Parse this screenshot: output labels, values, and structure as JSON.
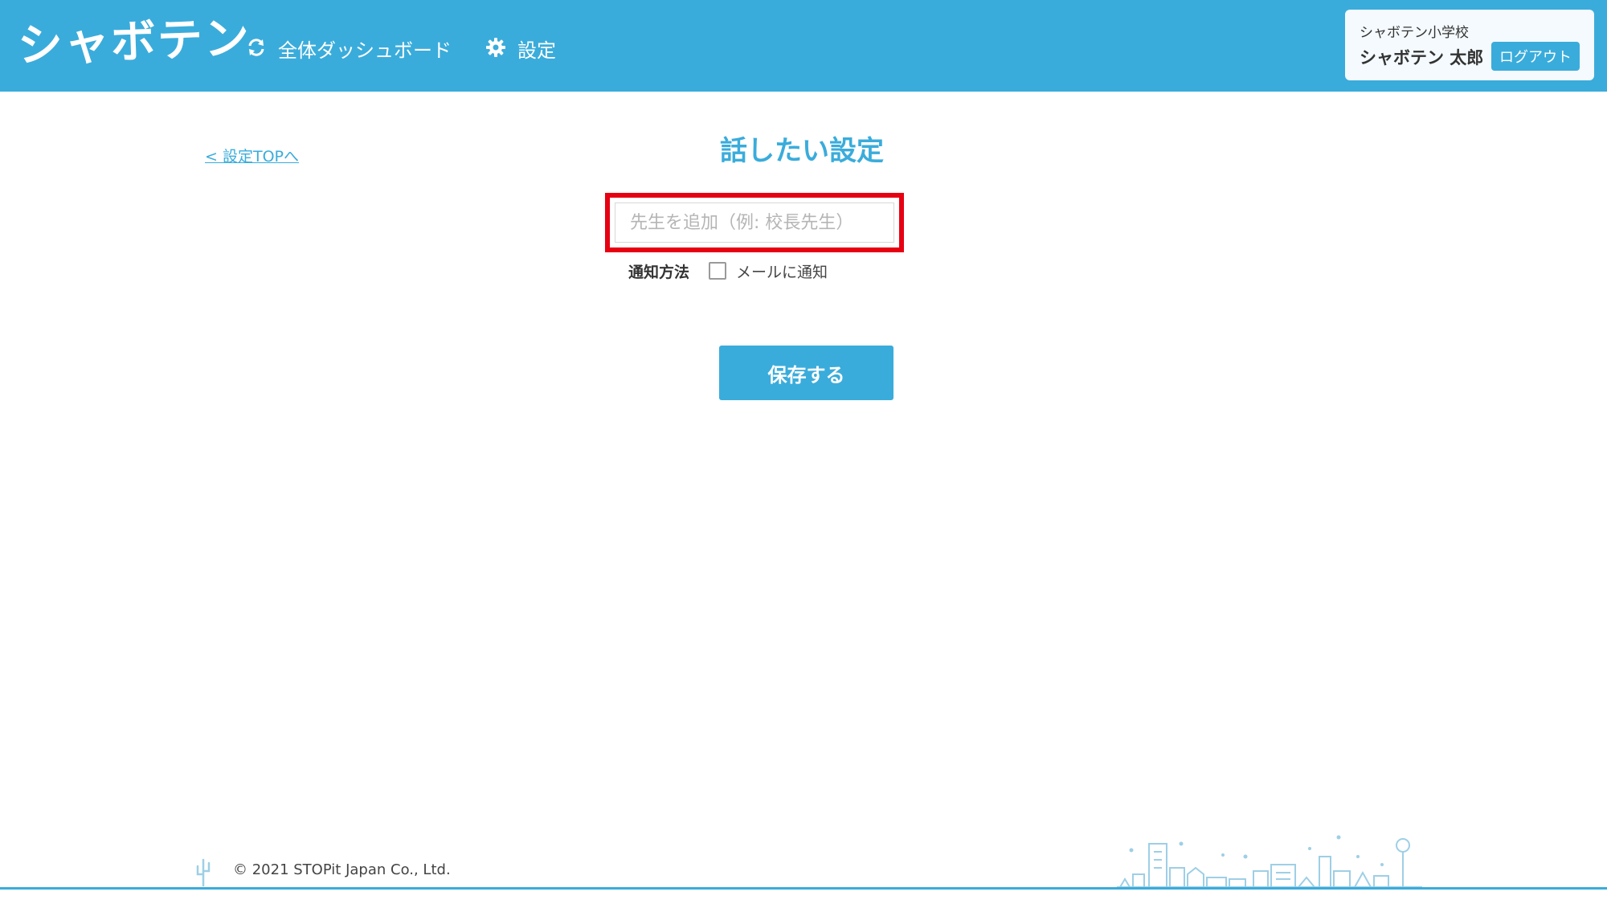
{
  "header": {
    "logo": "シャボテン",
    "nav": {
      "dashboard_label": "全体ダッシュボード",
      "dashboard_icon": "sync-icon",
      "settings_label": "設定",
      "settings_icon": "gear-icon"
    },
    "user": {
      "school": "シャボテン小学校",
      "name": "シャボテン 太郎",
      "logout_label": "ログアウト"
    }
  },
  "main": {
    "back_link": "< 設定TOPへ",
    "title": "話したい設定",
    "teacher_input": {
      "value": "",
      "placeholder": "先生を追加（例: 校長先生）"
    },
    "notify": {
      "label": "通知方法",
      "checkbox_label": "メールに通知",
      "checked": false
    },
    "save_label": "保存する"
  },
  "footer": {
    "copyright": "© 2021 STOPit Japan Co., Ltd."
  },
  "colors": {
    "brand": "#3aacdb",
    "highlight": "#e60012"
  }
}
